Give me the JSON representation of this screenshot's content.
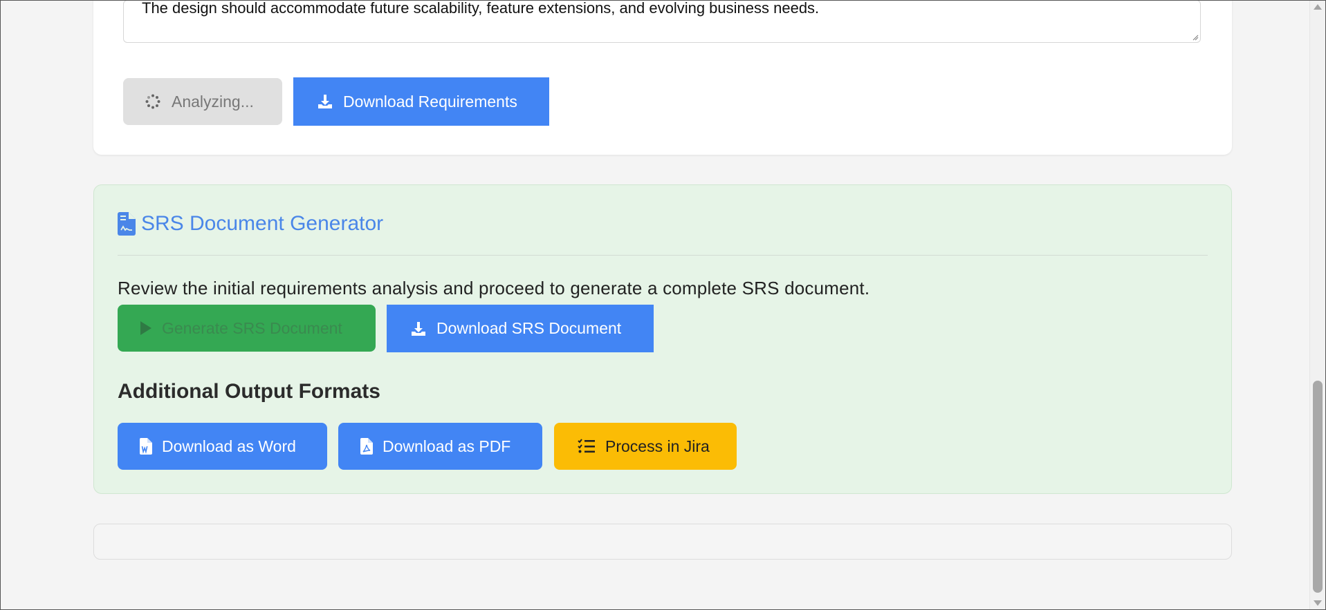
{
  "requirements": {
    "textarea_text": "The design should accommodate future scalability, feature extensions, and evolving business needs.",
    "analyzing_label": "Analyzing...",
    "download_requirements_label": "Download Requirements"
  },
  "srs": {
    "title": "SRS Document Generator",
    "description": "Review the initial requirements analysis and proceed to generate a complete SRS document.",
    "generate_label": "Generate SRS Document",
    "download_label": "Download SRS Document"
  },
  "additional": {
    "title": "Additional Output Formats",
    "word_label": "Download as Word",
    "pdf_label": "Download as PDF",
    "jira_label": "Process in Jira"
  },
  "colors": {
    "primary_blue": "#4285f4",
    "success_green": "#34a853",
    "warning_yellow": "#fbbc05",
    "srs_background": "#e6f4e7"
  },
  "icons": {
    "analyzing": "spinner-icon",
    "download": "download-icon",
    "srs_title": "file-contract-icon",
    "generate": "play-icon",
    "word": "file-word-icon",
    "pdf": "file-pdf-icon",
    "jira": "tasks-icon"
  }
}
